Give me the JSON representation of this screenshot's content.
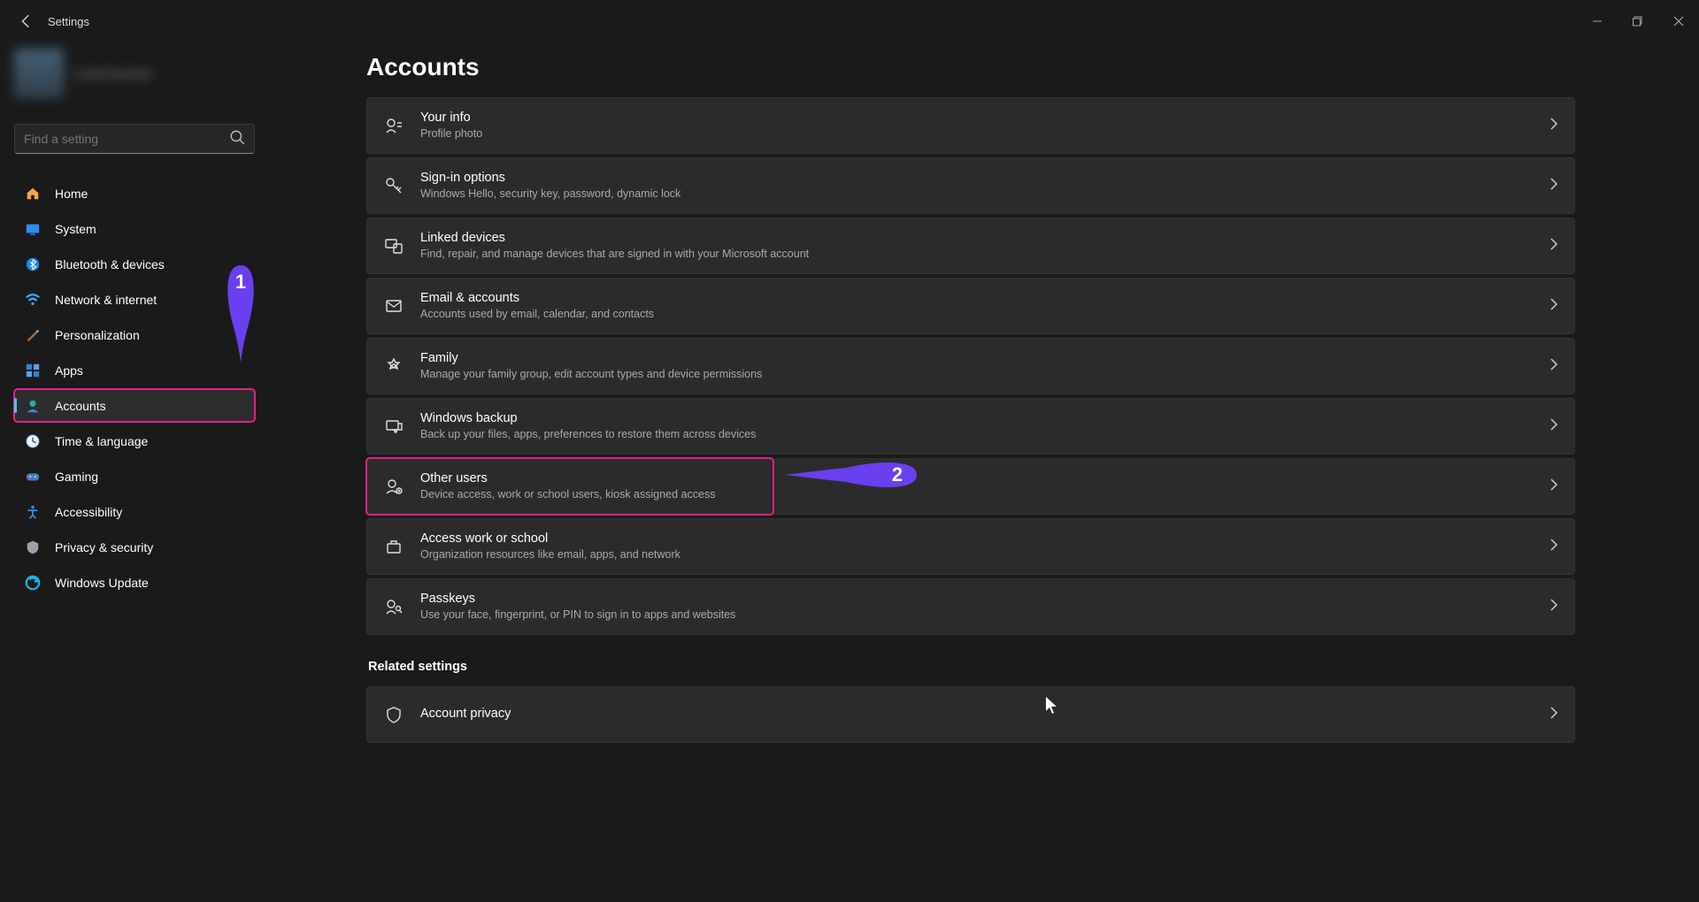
{
  "window": {
    "title": "Settings"
  },
  "search": {
    "placeholder": "Find a setting"
  },
  "user": {
    "name": "Local Account"
  },
  "nav": [
    {
      "label": "Home",
      "icon": "home"
    },
    {
      "label": "System",
      "icon": "system"
    },
    {
      "label": "Bluetooth & devices",
      "icon": "bluetooth"
    },
    {
      "label": "Network & internet",
      "icon": "network"
    },
    {
      "label": "Personalization",
      "icon": "personalization"
    },
    {
      "label": "Apps",
      "icon": "apps"
    },
    {
      "label": "Accounts",
      "icon": "accounts",
      "selected": true,
      "annotated": true
    },
    {
      "label": "Time & language",
      "icon": "time"
    },
    {
      "label": "Gaming",
      "icon": "gaming"
    },
    {
      "label": "Accessibility",
      "icon": "accessibility"
    },
    {
      "label": "Privacy & security",
      "icon": "privacy"
    },
    {
      "label": "Windows Update",
      "icon": "update"
    }
  ],
  "page": {
    "title": "Accounts",
    "items": [
      {
        "title": "Your info",
        "sub": "Profile photo",
        "icon": "yourinfo"
      },
      {
        "title": "Sign-in options",
        "sub": "Windows Hello, security key, password, dynamic lock",
        "icon": "key"
      },
      {
        "title": "Linked devices",
        "sub": "Find, repair, and manage devices that are signed in with your Microsoft account",
        "icon": "linked"
      },
      {
        "title": "Email & accounts",
        "sub": "Accounts used by email, calendar, and contacts",
        "icon": "email"
      },
      {
        "title": "Family",
        "sub": "Manage your family group, edit account types and device permissions",
        "icon": "family"
      },
      {
        "title": "Windows backup",
        "sub": "Back up your files, apps, preferences to restore them across devices",
        "icon": "backup"
      },
      {
        "title": "Other users",
        "sub": "Device access, work or school users, kiosk assigned access",
        "icon": "otherusers",
        "annotated": true
      },
      {
        "title": "Access work or school",
        "sub": "Organization resources like email, apps, and network",
        "icon": "work"
      },
      {
        "title": "Passkeys",
        "sub": "Use your face, fingerprint, or PIN to sign in to apps and websites",
        "icon": "passkeys"
      }
    ],
    "related_label": "Related settings",
    "related": [
      {
        "title": "Account privacy",
        "sub": "",
        "icon": "privacy2"
      }
    ]
  },
  "annotations": {
    "one": "1",
    "two": "2"
  }
}
